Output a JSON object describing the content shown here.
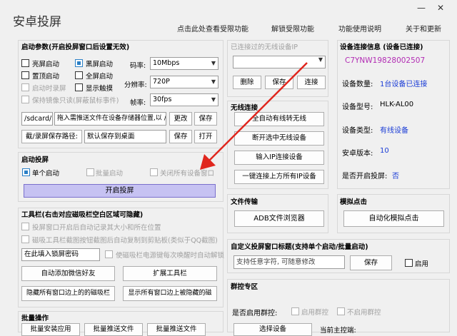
{
  "window": {
    "title": "安卓投屏",
    "minimize": "—",
    "close": "✕"
  },
  "topnav": [
    "点击此处查看受限功能",
    "解锁受限功能",
    "功能使用说明",
    "关于和更新"
  ],
  "startup": {
    "title": "启动参数(开启投屏窗口后设置无效)",
    "checkboxes": [
      {
        "label": "亮屏启动",
        "checked": false,
        "disabled": false
      },
      {
        "label": "黑屏启动",
        "checked": true,
        "disabled": false
      },
      {
        "label": "置顶启动",
        "checked": false,
        "disabled": false
      },
      {
        "label": "全屏启动",
        "checked": false,
        "disabled": false
      },
      {
        "label": "启动时录屏",
        "checked": false,
        "disabled": true
      },
      {
        "label": "显示触摸",
        "checked": false,
        "disabled": false
      },
      {
        "label": "保持镜像只读(屏蔽鼠标事件)",
        "checked": false,
        "disabled": true
      }
    ],
    "bitrate_label": "码率:",
    "bitrate_value": "10Mbps",
    "resolution_label": "分辨率:",
    "resolution_value": "720P",
    "fps_label": "帧率:",
    "fps_value": "30fps",
    "path_value": "/sdcard/",
    "push_hint": "拖入需推送文件在设备存储器位置,以 / 结尾",
    "change_btn": "更改",
    "save_btn": "保存",
    "record_path_placeholder": "截/录屏保存路径:",
    "record_path_value": "默认保存到桌面",
    "save_btn2": "保存",
    "open_btn": "打开"
  },
  "launch": {
    "title": "启动投屏",
    "single": "单个启动",
    "batch": "批量启动",
    "close_all": "关闭所有设备窗口",
    "start_btn": "开启投屏"
  },
  "toolbar": {
    "title": "工具栏(右击对应磁吸栏空白区域可隐藏)",
    "opt1": "投屏窗口开启后自动记录其大小和所在位置",
    "opt2": "磁吸工具栏截图按钮截图后自动复制到剪贴板(类似于QQ截图)",
    "pwd_placeholder": "在此填入锁屏密码",
    "opt3": "使磁吸栏电源键每次唤醒时自动解锁",
    "add_wechat_btn": "自动添加微信好友",
    "expand_btn": "扩展工具栏",
    "hide_btn": "隐藏所有窗口边上的的磁吸栏",
    "show_btn": "显示所有窗口边上被隐藏的磁"
  },
  "batch": {
    "title": "批量操作",
    "btn1": "批量安装应用",
    "btn2": "批量推送文件",
    "btn3": "批量推送文件"
  },
  "wifi": {
    "title": "已连接过的无线设备IP",
    "delete_btn": "删除",
    "save_btn": "保存",
    "connect_btn": "连接"
  },
  "wireless": {
    "title": "无线连接",
    "btn1": "全自动有线转无线",
    "btn2": "断开选中无线设备",
    "btn3": "输入IP连接设备",
    "btn4": "一键连接上方所有IP设备"
  },
  "device": {
    "title": "设备连接信息 (设备已连接)",
    "serial": "C7YNW19828002507",
    "count_label": "设备数量:",
    "count_value": "1台设备已连接",
    "model_label": "设备型号:",
    "model_value": "HLK-AL00",
    "type_label": "设备类型:",
    "type_value": "有线设备",
    "android_label": "安卓版本:",
    "android_value": "10",
    "casting_label": "是否开启投屏:",
    "casting_value": "否"
  },
  "file": {
    "title": "文件传输",
    "adb_btn": "ADB文件浏览器"
  },
  "simulate": {
    "title": "模拟点击",
    "auto_btn": "自动化模拟点击"
  },
  "custom": {
    "title": "自定义投屏窗口标题(支持单个启动/批量启动)",
    "placeholder": "支持任意字符, 可随意修改",
    "save_btn": "保存",
    "enable": "启用"
  },
  "group_ctrl": {
    "title": "群控专区",
    "q_label": "是否启用群控:",
    "enable": "启用群控",
    "disable": "不启用群控",
    "bottom_btn": "选择设备",
    "bottom_label": "当前主控端:"
  },
  "colors": {
    "accent": "#2b80c6",
    "arrow": "#e0261e",
    "purple": "#b22cb4",
    "blue": "#1a3cd6"
  }
}
